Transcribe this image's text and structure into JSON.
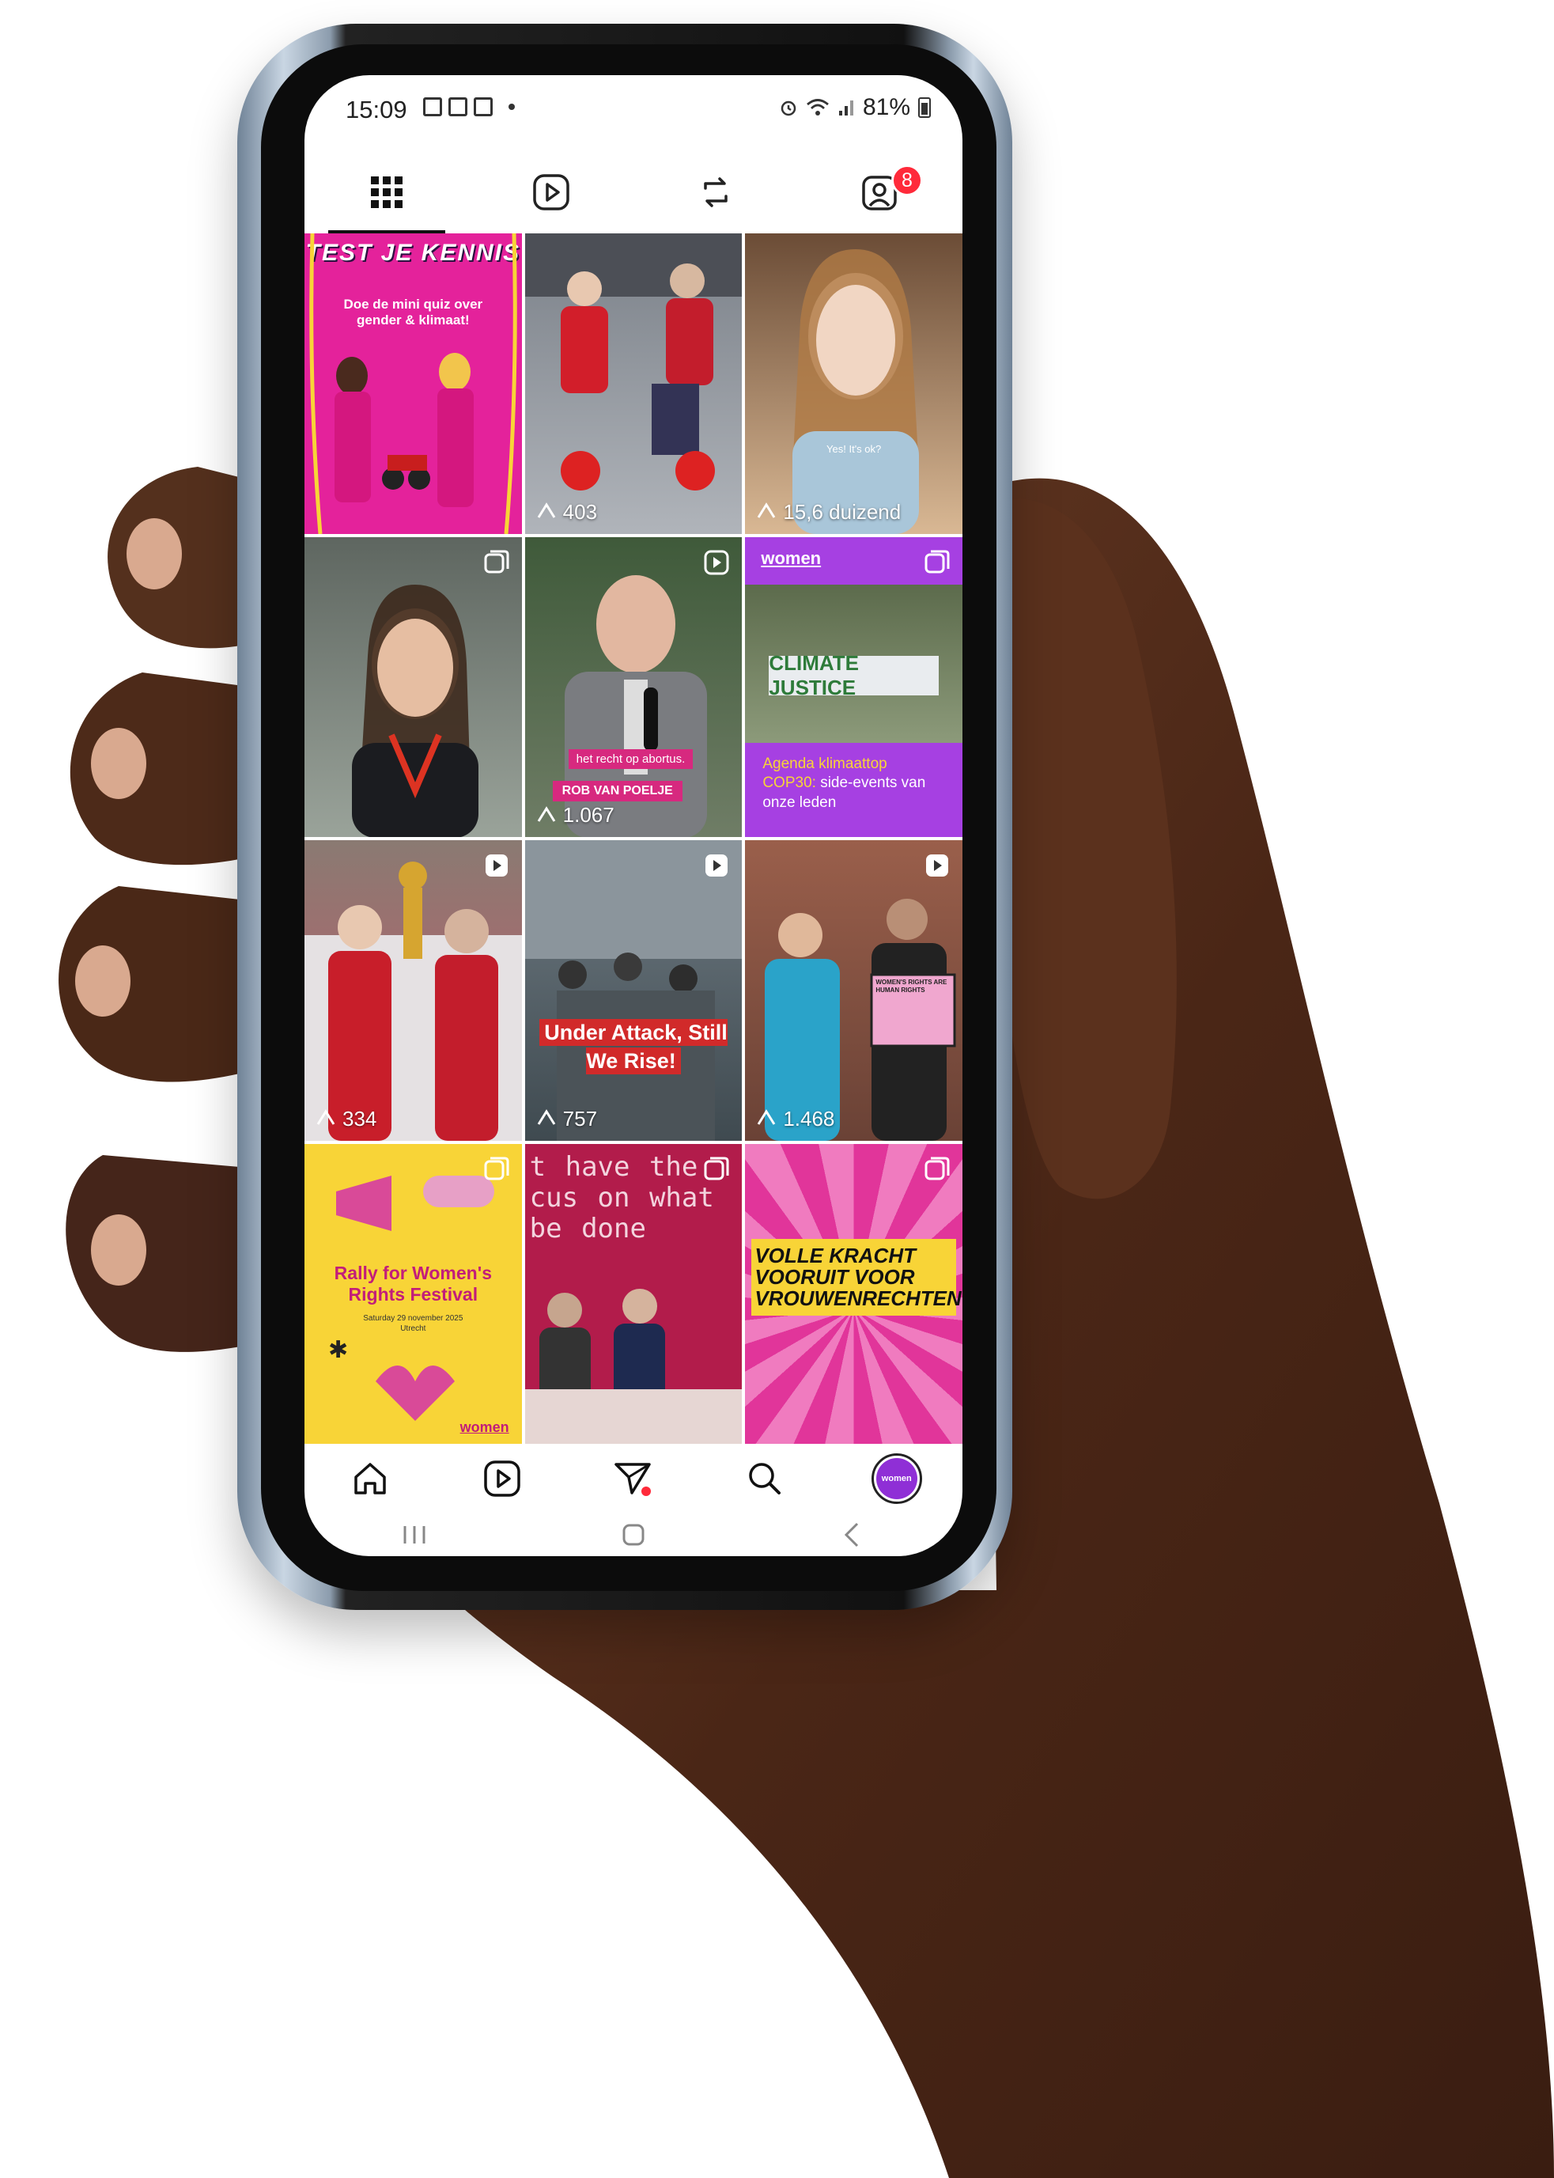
{
  "status": {
    "time": "15:09",
    "battery": "81%"
  },
  "tabs": {
    "grid": "grid-icon",
    "reels": "reels-icon",
    "reposts": "repost-icon",
    "tagged": "tagged-icon",
    "tagged_badge": "8"
  },
  "posts": [
    {
      "title": "TEST JE KENNIS",
      "subtitle": "Doe de mini quiz over gender & klimaat!",
      "bg": "#e4229b"
    },
    {
      "views": "403",
      "bg": "#8a8f98"
    },
    {
      "views": "15,6 duizend",
      "caption": "Yes! It's ok?",
      "bg": "#c7a47e"
    },
    {
      "bg": "#6b6f6a"
    },
    {
      "caption": "het recht op abortus.",
      "name": "ROB VAN POELJE",
      "views": "1.067",
      "bg": "#4d5a48"
    },
    {
      "logo": "women",
      "body_highlight": "Agenda klimaattop COP30:",
      "body": " side-events van onze leden",
      "banner": "CLIMATE JUSTICE",
      "bg": "#a640e2"
    },
    {
      "views": "334",
      "bg": "#b84b5c"
    },
    {
      "caption": "Under Attack, Still We Rise!",
      "views": "757",
      "bg": "#5f6a6e"
    },
    {
      "sign": "WOMEN'S RIGHTS ARE HUMAN RIGHTS",
      "views": "1.468",
      "bg": "#8b5a4a"
    },
    {
      "title": "Rally for Women's Rights Festival",
      "date": "Saturday 29 november 2025",
      "city": "Utrecht",
      "logo": "women",
      "bg": "#f8d437"
    },
    {
      "wall_text": "t have the cus on what be done",
      "bg": "#b21c4b"
    },
    {
      "title": "VOLLE KRACHT VOORUIT VOOR VROUWENRECHTEN",
      "bg": "#e1359a"
    }
  ],
  "bottom_nav": {
    "home": "home-icon",
    "reels": "reels-icon",
    "messages": "send-icon",
    "search": "search-icon",
    "profile_label": "women"
  },
  "colors": {
    "accent_pink": "#e4229b",
    "accent_purple": "#a640e2",
    "accent_yellow": "#f8d437",
    "notification_red": "#ff2a3a"
  }
}
